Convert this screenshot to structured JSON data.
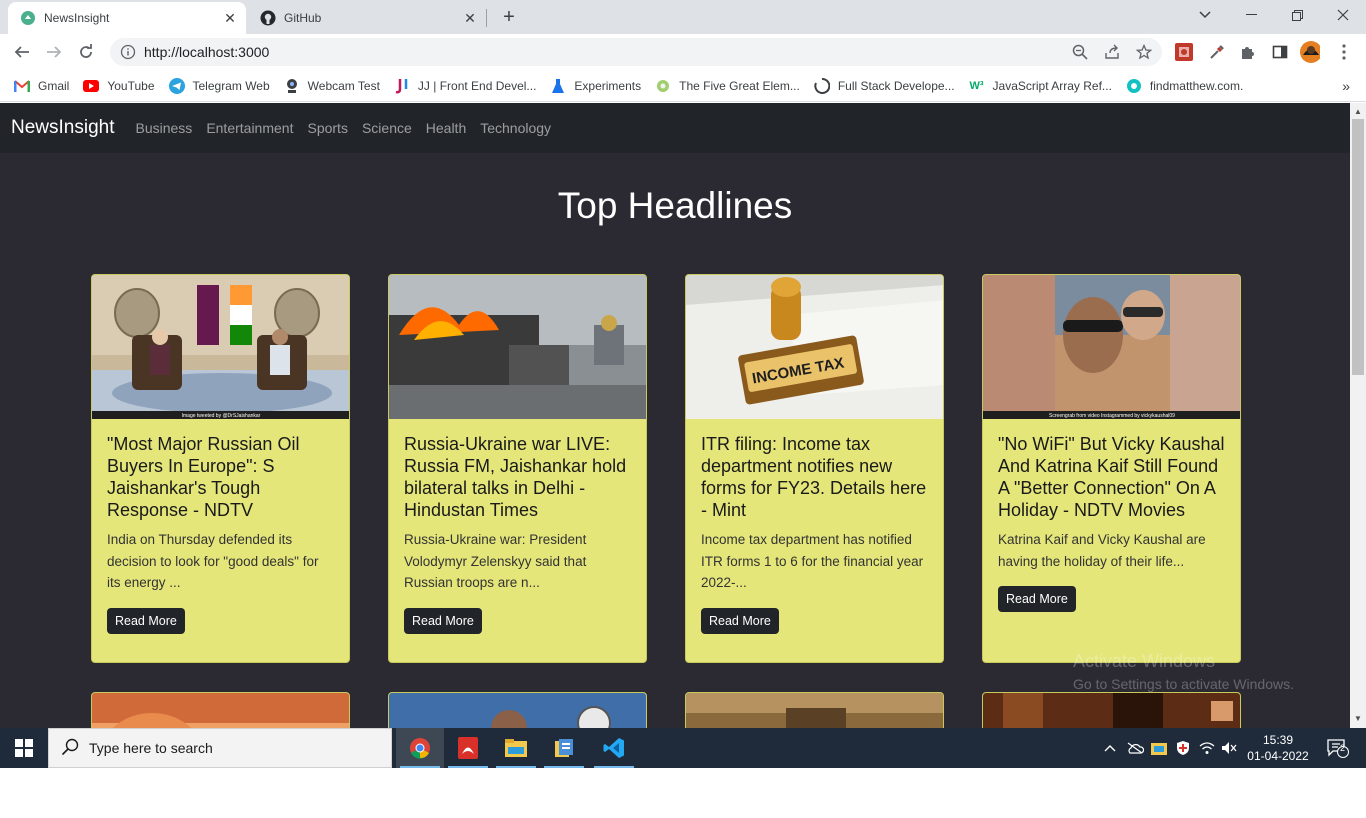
{
  "browser": {
    "tabs": [
      {
        "title": "NewsInsight",
        "active": true,
        "icon": "newsinsight-favicon"
      },
      {
        "title": "GitHub",
        "active": false,
        "icon": "github-icon"
      }
    ],
    "url": "http://localhost:3000",
    "bookmarks": [
      {
        "label": "Gmail",
        "icon": "gmail-icon"
      },
      {
        "label": "YouTube",
        "icon": "youtube-icon"
      },
      {
        "label": "Telegram Web",
        "icon": "telegram-icon"
      },
      {
        "label": "Webcam Test",
        "icon": "webcam-icon"
      },
      {
        "label": "JJ | Front End Devel...",
        "icon": "jj-icon"
      },
      {
        "label": "Experiments",
        "icon": "flask-icon"
      },
      {
        "label": "The Five Great Elem...",
        "icon": "leaf-icon"
      },
      {
        "label": "Full Stack Develope...",
        "icon": "spinner-icon"
      },
      {
        "label": "JavaScript Array Ref...",
        "icon": "w3-icon"
      },
      {
        "label": "findmatthew.com.",
        "icon": "fm-icon"
      }
    ]
  },
  "site": {
    "brand": "NewsInsight",
    "nav": [
      "Business",
      "Entertainment",
      "Sports",
      "Science",
      "Health",
      "Technology"
    ],
    "heading": "Top Headlines",
    "read_more": "Read More",
    "cards": [
      {
        "title": "\"Most Major Russian Oil Buyers In Europe\": S Jaishankar's Tough Response - NDTV",
        "desc": "India on Thursday defended its decision to look for \"good deals\" for its energy ...",
        "image_caption": "Image tweeted by @DrSJaishankar"
      },
      {
        "title": "Russia-Ukraine war LIVE: Russia FM, Jaishankar hold bilateral talks in Delhi - Hindustan Times",
        "desc": "Russia-Ukraine war: President Volodymyr Zelenskyy said that Russian troops are n...",
        "image_caption": ""
      },
      {
        "title": "ITR filing: Income tax department notifies new forms for FY23. Details here - Mint",
        "desc": "Income tax department has notified ITR forms 1 to 6 for the financial year 2022-...",
        "image_caption": "INCOME TAX"
      },
      {
        "title": "\"No WiFi\" But Vicky Kaushal And Katrina Kaif Still Found A \"Better Connection\" On A Holiday - NDTV Movies",
        "desc": "Katrina Kaif and Vicky Kaushal are having the holiday of their life...",
        "image_caption": "Screengrab from video Instagrammed by vickykaushal09"
      }
    ]
  },
  "watermark": {
    "line1": "Activate Windows",
    "line2": "Go to Settings to activate Windows."
  },
  "taskbar": {
    "search_placeholder": "Type here to search",
    "time": "15:39",
    "date": "01-04-2022",
    "notifications": "2"
  }
}
